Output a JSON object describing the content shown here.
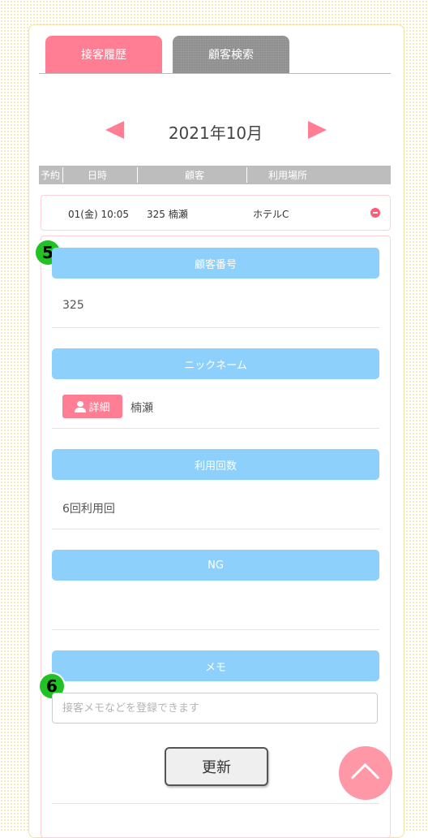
{
  "tabs": [
    {
      "label": "接客履歴",
      "active": true
    },
    {
      "label": "顧客検索",
      "active": false
    }
  ],
  "calendar": {
    "month_label": "2021年10月"
  },
  "table_header": {
    "col_reservation": "予約",
    "col_datetime": "日時",
    "col_customer": "顧客",
    "col_location": "利用場所"
  },
  "row": {
    "datetime": "01(金) 10:05",
    "customer": "325 楠瀬",
    "location": "ホテルC"
  },
  "details": {
    "customer_number_label": "顧客番号",
    "customer_number_value": "325",
    "nickname_label": "ニックネーム",
    "detail_button_label": "詳細",
    "nickname_value": "楠瀬",
    "usage_count_label": "利用回数",
    "usage_count_value": "6回利用回",
    "ng_label": "NG",
    "ng_value": "",
    "memo_label": "メモ",
    "memo_placeholder": "接客メモなどを登録できます",
    "memo_value": "",
    "update_button_label": "更新"
  },
  "annotations": {
    "badge_5": "5",
    "badge_6": "6"
  },
  "colors": {
    "accent_pink": "#ff7e93",
    "bar_blue": "#8dd0fb",
    "badge_green": "#20c225",
    "header_gray": "#bdbdbd"
  },
  "icons": [
    "prev-month-icon",
    "next-month-icon",
    "remove-icon",
    "person-icon",
    "scroll-top-icon"
  ]
}
